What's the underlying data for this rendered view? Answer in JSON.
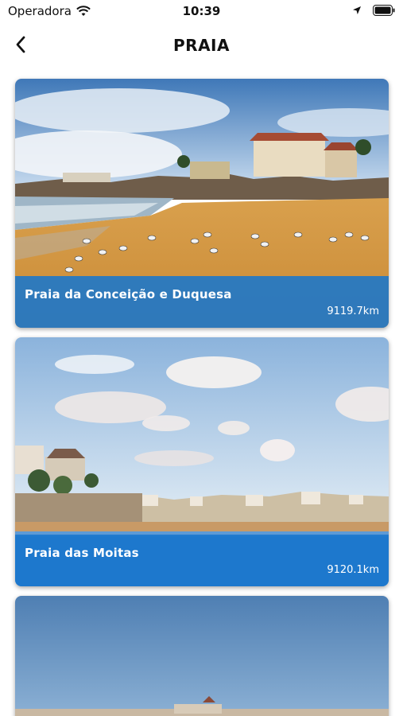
{
  "status": {
    "carrier": "Operadora",
    "time": "10:39",
    "icons": [
      "wifi-icon",
      "location-arrow-icon",
      "battery-icon"
    ]
  },
  "header": {
    "title": "PRAIA",
    "back_icon": "chevron-left-icon"
  },
  "beaches": [
    {
      "name": "Praia da Conceição e Duquesa",
      "distance": "9119.7km"
    },
    {
      "name": "Praia das Moitas",
      "distance": "9120.1km"
    },
    {
      "name": "",
      "distance": ""
    }
  ],
  "colors": {
    "overlay": "#1976CD",
    "text": "#111111"
  }
}
